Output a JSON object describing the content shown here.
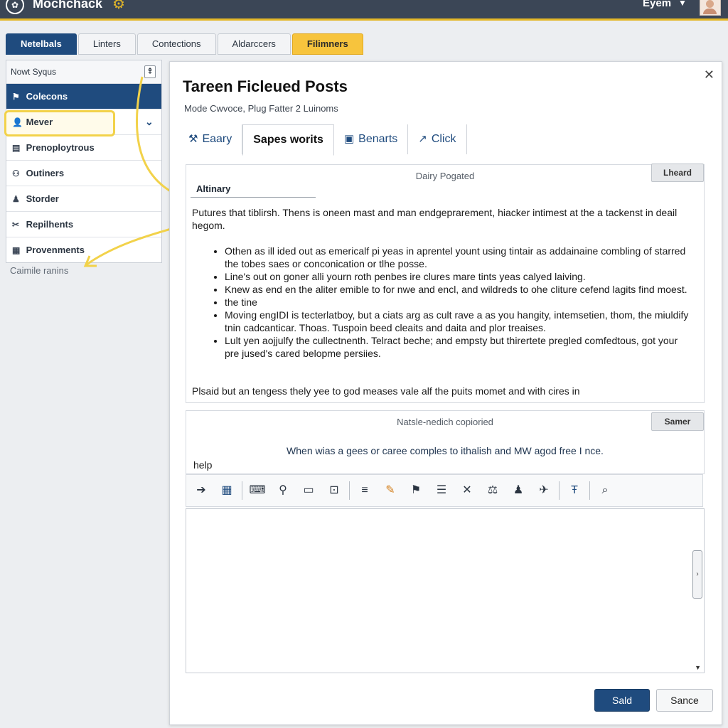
{
  "app": {
    "title": "Mochchack",
    "user_name": "Eyem"
  },
  "main_tabs": [
    "Netelbals",
    "Linters",
    "Contections",
    "Aldarccers",
    "Filimners"
  ],
  "sidebar": {
    "header": "Nowt Syqus",
    "items": [
      {
        "label": "Colecons",
        "icon": "tag-icon"
      },
      {
        "label": "Mever",
        "icon": "user-icon"
      },
      {
        "label": "Prenoploytrous",
        "icon": "card-icon"
      },
      {
        "label": "Outiners",
        "icon": "users-icon"
      },
      {
        "label": "Storder",
        "icon": "person-icon"
      },
      {
        "label": "Repilhents",
        "icon": "tools-icon"
      },
      {
        "label": "Provenments",
        "icon": "grid-icon"
      }
    ],
    "footer": "Caimile ranins"
  },
  "dialog": {
    "title": "Tareen Ficleued Posts",
    "subtitle": "Mode Cwvoce, Plug Fatter 2 Luinoms",
    "tabs": [
      "Eaary",
      "Sapes worits",
      "Benarts",
      "Click"
    ],
    "panel1": {
      "caption": "Dairy Pogated",
      "button": "Lheard",
      "label": "Altinary",
      "intro": "Putures that tiblirsh. Thens is oneen mast and man endgeprarement, hiacker intimest at the a tackenst in deail hegom.",
      "bullets": [
        "Othen as ill ided out as emericalf pi yeas in aprentel yount using tintair as addainaine combling of starred the tobes saes or conconication or tlhe posse.",
        "Line's out on goner alli yourn roth penbes ire clures mare tints yeas calyed laiving.",
        "Knew as end en the aliter emible to for nwe and encl, and wildreds to ohe cliture cefend lagits find moest.",
        "the tine",
        "Moving engIDI is tecterlatboy, but a ciats arg as cult rave a as you hangity, intemsetien, thom, the miuldify tnin cadcanticar. Thoas. Tuspoin beed cleaits and daita and plor treaises.",
        "Lult yen aojjulfy the cullectnenth. Telract beche; and empsty but thirertete pregled comfedtous, got your pre jused's cared belopme persiies."
      ],
      "closing": "Plsaid but an tengess thely yee to god meases vale alf the puits momet and with cires in"
    },
    "panel2": {
      "caption": "Natsle-nedich copioried",
      "button": "Samer",
      "text": "When wias a gees or caree comples to ithalish and MW agod free I nce.",
      "help": "help"
    },
    "primary_button": "Sald",
    "secondary_button": "Sance"
  }
}
